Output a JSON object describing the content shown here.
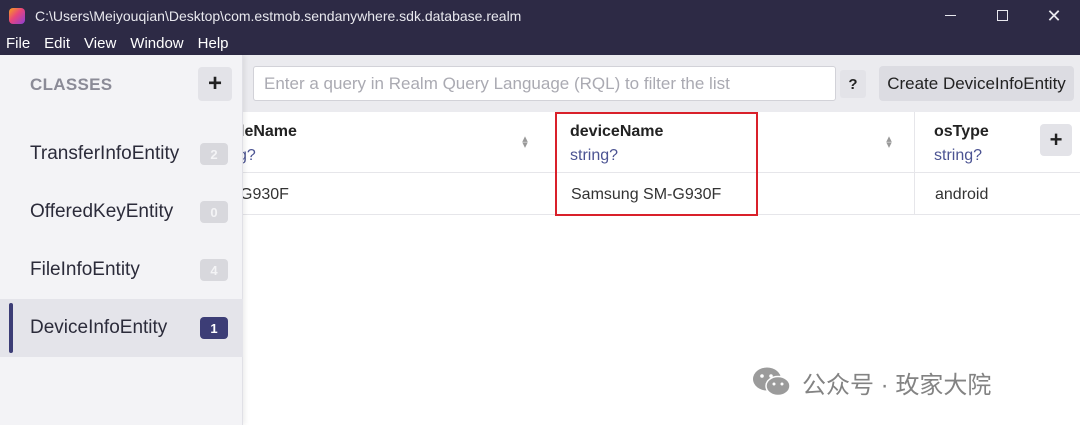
{
  "window": {
    "title": "C:\\Users\\Meiyouqian\\Desktop\\com.estmob.sendanywhere.sdk.database.realm"
  },
  "menu": [
    "File",
    "Edit",
    "View",
    "Window",
    "Help"
  ],
  "sidebar": {
    "heading": "CLASSES",
    "add_label": "+",
    "items": [
      {
        "label": "TransferInfoEntity",
        "count": "2"
      },
      {
        "label": "OfferedKeyEntity",
        "count": "0"
      },
      {
        "label": "FileInfoEntity",
        "count": "4"
      },
      {
        "label": "DeviceInfoEntity",
        "count": "1"
      }
    ]
  },
  "toolbar": {
    "query_placeholder": "Enter a query in Realm Query Language (RQL) to filter the list",
    "help_label": "?",
    "create_label": "Create DeviceInfoEntity"
  },
  "table": {
    "add_column_label": "+",
    "columns": [
      {
        "name": "leName",
        "type": "g?"
      },
      {
        "name": "deviceName",
        "type": "string?"
      },
      {
        "name": "osType",
        "type": "string?"
      }
    ],
    "rows": [
      {
        "cells": [
          "G930F",
          "Samsung SM-G930F",
          "android"
        ]
      }
    ]
  },
  "watermark": {
    "text": "公众号 · 玫家大院"
  },
  "colors": {
    "titlebar": "#2d2a45",
    "selected_accent": "#3c3d76",
    "type_text": "#4b5392",
    "highlight": "#d9202a"
  }
}
